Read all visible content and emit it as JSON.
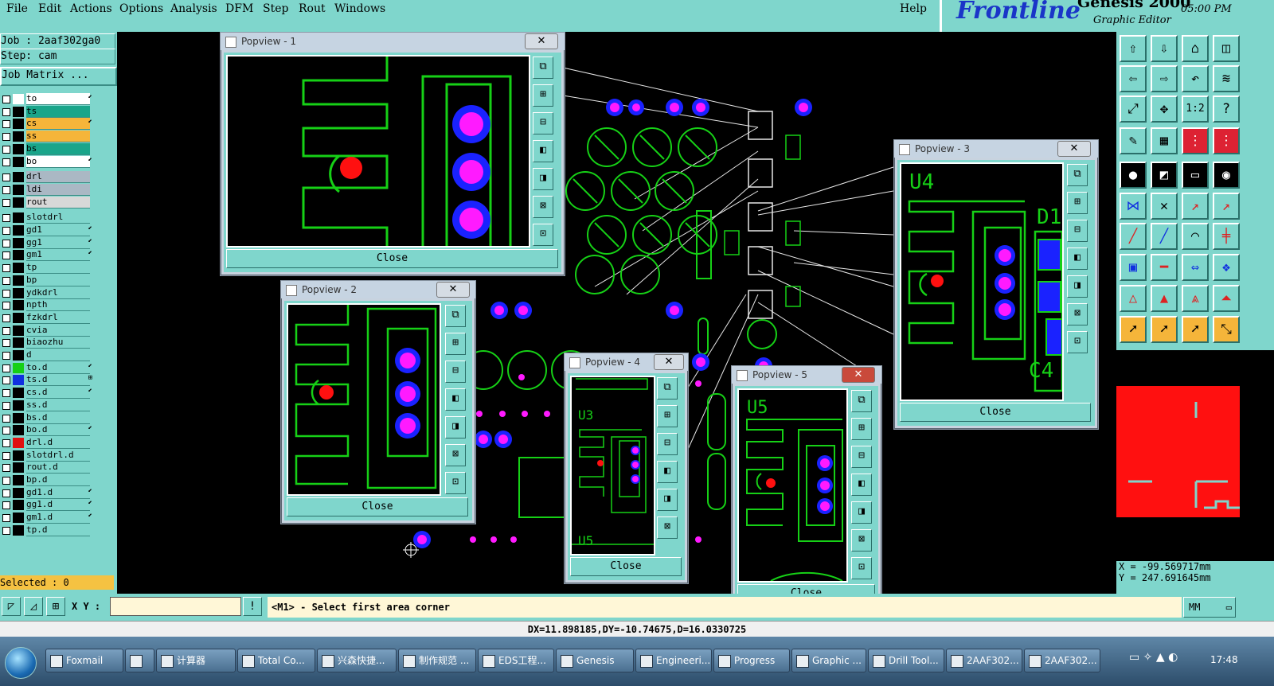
{
  "menubar": {
    "items": [
      "File",
      "Edit",
      "Actions",
      "Options",
      "Analysis",
      "DFM",
      "Step",
      "Rout",
      "Windows"
    ],
    "help": "Help"
  },
  "brand": {
    "logo": "Frontline",
    "product": "Genesis 2000",
    "subtitle": "Graphic Editor",
    "time": "05:00 PM"
  },
  "left_panel": {
    "job": "Job : 2aaf302ga0",
    "step": "Step: cam",
    "job_matrix": "Job Matrix ...",
    "selected": "Selected : 0",
    "layers": [
      {
        "name": "to",
        "color": "#ffffff",
        "bg": "#ffffff",
        "mark": "⬋"
      },
      {
        "name": "ts",
        "color": "#000000",
        "bg": "#1aa58a",
        "mark": ""
      },
      {
        "name": "cs",
        "color": "#000000",
        "bg": "#f5b53a",
        "mark": "⬋"
      },
      {
        "name": "ss",
        "color": "#000000",
        "bg": "#f5b53a",
        "mark": ""
      },
      {
        "name": "bs",
        "color": "#000000",
        "bg": "#1aa58a",
        "mark": ""
      },
      {
        "name": "bo",
        "color": "#000000",
        "bg": "#ffffff",
        "mark": "⬋"
      },
      {
        "name": "drl",
        "color": "#000000",
        "bg": "#aab8c4",
        "mark": ""
      },
      {
        "name": "ldi",
        "color": "#000000",
        "bg": "#aab8c4",
        "mark": ""
      },
      {
        "name": "rout",
        "color": "#000000",
        "bg": "#d8d8d8",
        "mark": ""
      },
      {
        "name": "slotdrl",
        "color": "#000000",
        "bg": "#7fd6cc",
        "mark": ""
      },
      {
        "name": "gd1",
        "color": "#000000",
        "bg": "#7fd6cc",
        "mark": "⬋"
      },
      {
        "name": "gg1",
        "color": "#000000",
        "bg": "#7fd6cc",
        "mark": "⬋"
      },
      {
        "name": "gm1",
        "color": "#000000",
        "bg": "#7fd6cc",
        "mark": "⬋"
      },
      {
        "name": "tp",
        "color": "#000000",
        "bg": "#7fd6cc",
        "mark": ""
      },
      {
        "name": "bp",
        "color": "#000000",
        "bg": "#7fd6cc",
        "mark": ""
      },
      {
        "name": "ydkdrl",
        "color": "#000000",
        "bg": "#7fd6cc",
        "mark": ""
      },
      {
        "name": "npth",
        "color": "#000000",
        "bg": "#7fd6cc",
        "mark": ""
      },
      {
        "name": "fzkdrl",
        "color": "#000000",
        "bg": "#7fd6cc",
        "mark": ""
      },
      {
        "name": "cvia",
        "color": "#000000",
        "bg": "#7fd6cc",
        "mark": ""
      },
      {
        "name": "biaozhu",
        "color": "#000000",
        "bg": "#7fd6cc",
        "mark": ""
      },
      {
        "name": "d",
        "color": "#000000",
        "bg": "#7fd6cc",
        "mark": ""
      },
      {
        "name": "to.d",
        "color": "#16d016",
        "bg": "#7fd6cc",
        "mark": "⬋"
      },
      {
        "name": "ts.d",
        "color": "#1030e0",
        "bg": "#7fd6cc",
        "mark": "⊞"
      },
      {
        "name": "cs.d",
        "color": "#000000",
        "bg": "#7fd6cc",
        "mark": "⬋"
      },
      {
        "name": "ss.d",
        "color": "#000000",
        "bg": "#7fd6cc",
        "mark": ""
      },
      {
        "name": "bs.d",
        "color": "#000000",
        "bg": "#7fd6cc",
        "mark": ""
      },
      {
        "name": "bo.d",
        "color": "#000000",
        "bg": "#7fd6cc",
        "mark": "⬋"
      },
      {
        "name": "drl.d",
        "color": "#e01010",
        "bg": "#7fd6cc",
        "mark": ""
      },
      {
        "name": "slotdrl.d",
        "color": "#000000",
        "bg": "#7fd6cc",
        "mark": ""
      },
      {
        "name": "rout.d",
        "color": "#000000",
        "bg": "#7fd6cc",
        "mark": ""
      },
      {
        "name": "bp.d",
        "color": "#000000",
        "bg": "#7fd6cc",
        "mark": ""
      },
      {
        "name": "gd1.d",
        "color": "#000000",
        "bg": "#7fd6cc",
        "mark": "⬋"
      },
      {
        "name": "gg1.d",
        "color": "#000000",
        "bg": "#7fd6cc",
        "mark": "⬋"
      },
      {
        "name": "gm1.d",
        "color": "#000000",
        "bg": "#7fd6cc",
        "mark": "⬋"
      },
      {
        "name": "tp.d",
        "color": "#000000",
        "bg": "#7fd6cc",
        "mark": ""
      }
    ]
  },
  "popviews": [
    {
      "title": "Popview - 1",
      "close_label": "Close",
      "x_label": "✕"
    },
    {
      "title": "Popview - 2",
      "close_label": "Close",
      "x_label": "✕"
    },
    {
      "title": "Popview - 3",
      "close_label": "Close",
      "x_label": "✕"
    },
    {
      "title": "Popview - 4",
      "close_label": "Close",
      "x_label": "✕"
    },
    {
      "title": "Popview - 5",
      "close_label": "Close",
      "x_label": "✕"
    }
  ],
  "popview_labels": {
    "p3_top": "U4",
    "p3_side": "D1",
    "p3_bottom": "C4",
    "p4_top": "U3",
    "p4_bottom": "U5",
    "p5_top": "U5"
  },
  "bottom": {
    "xy_label": "X Y :",
    "xy_value": "",
    "message": "<M1> - Select first area corner",
    "units": "MM",
    "delta": "DX=11.898185,DY=-10.74675,D=16.0330725"
  },
  "coords": {
    "x": "X = -99.569717mm",
    "y": "Y = 247.691645mm"
  },
  "taskbar": {
    "items": [
      "Foxmail",
      "",
      "计算器",
      "Total Co...",
      "兴森快捷...",
      "制作规范 ...",
      "EDS工程...",
      "Genesis",
      "Engineeri...",
      "Progress",
      "Graphic ...",
      "Drill Tool...",
      "2AAF302...",
      "2AAF302..."
    ],
    "clock": "17:48"
  },
  "colors": {
    "panel": "#7fd6cc",
    "trace": "#16d016",
    "pad": "#ff1aff",
    "pad_ring": "#1a22ff",
    "drill": "#ff1010",
    "message_bg": "#fff7d7"
  }
}
